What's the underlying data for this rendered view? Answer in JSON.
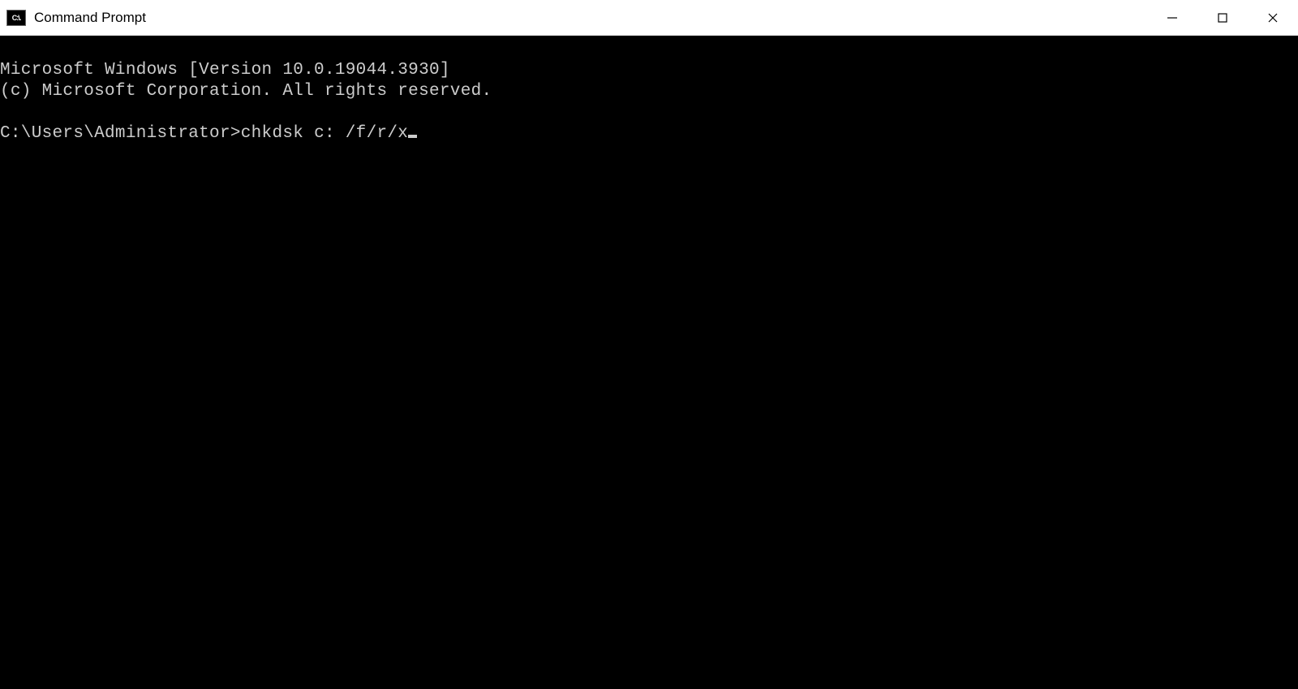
{
  "window": {
    "title": "Command Prompt",
    "icon_label": "C:\\."
  },
  "terminal": {
    "line1": "Microsoft Windows [Version 10.0.19044.3930]",
    "line2": "(c) Microsoft Corporation. All rights reserved.",
    "blank": "",
    "prompt": "C:\\Users\\Administrator>",
    "command": "chkdsk c: /f/r/x"
  }
}
